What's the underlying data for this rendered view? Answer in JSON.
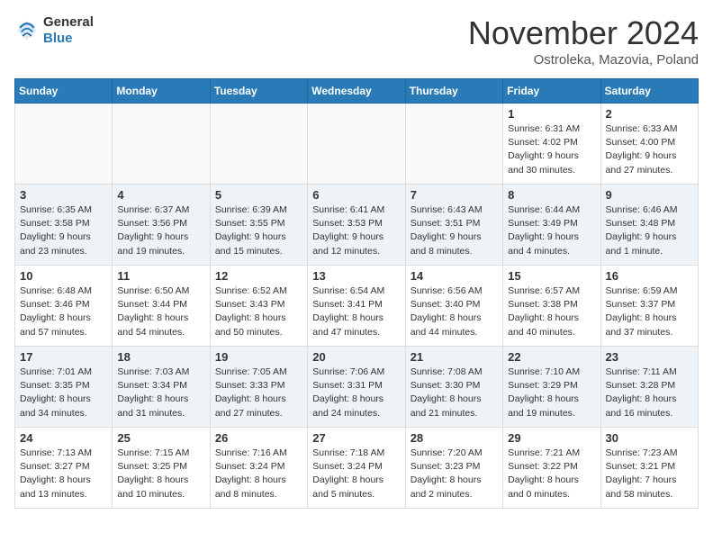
{
  "header": {
    "logo_general": "General",
    "logo_blue": "Blue",
    "month_title": "November 2024",
    "subtitle": "Ostroleka, Mazovia, Poland"
  },
  "weekdays": [
    "Sunday",
    "Monday",
    "Tuesday",
    "Wednesday",
    "Thursday",
    "Friday",
    "Saturday"
  ],
  "weeks": [
    [
      {
        "day": "",
        "sunrise": "",
        "sunset": "",
        "daylight": "",
        "empty": true
      },
      {
        "day": "",
        "sunrise": "",
        "sunset": "",
        "daylight": "",
        "empty": true
      },
      {
        "day": "",
        "sunrise": "",
        "sunset": "",
        "daylight": "",
        "empty": true
      },
      {
        "day": "",
        "sunrise": "",
        "sunset": "",
        "daylight": "",
        "empty": true
      },
      {
        "day": "",
        "sunrise": "",
        "sunset": "",
        "daylight": "",
        "empty": true
      },
      {
        "day": "1",
        "sunrise": "Sunrise: 6:31 AM",
        "sunset": "Sunset: 4:02 PM",
        "daylight": "Daylight: 9 hours and 30 minutes.",
        "empty": false
      },
      {
        "day": "2",
        "sunrise": "Sunrise: 6:33 AM",
        "sunset": "Sunset: 4:00 PM",
        "daylight": "Daylight: 9 hours and 27 minutes.",
        "empty": false
      }
    ],
    [
      {
        "day": "3",
        "sunrise": "Sunrise: 6:35 AM",
        "sunset": "Sunset: 3:58 PM",
        "daylight": "Daylight: 9 hours and 23 minutes.",
        "empty": false
      },
      {
        "day": "4",
        "sunrise": "Sunrise: 6:37 AM",
        "sunset": "Sunset: 3:56 PM",
        "daylight": "Daylight: 9 hours and 19 minutes.",
        "empty": false
      },
      {
        "day": "5",
        "sunrise": "Sunrise: 6:39 AM",
        "sunset": "Sunset: 3:55 PM",
        "daylight": "Daylight: 9 hours and 15 minutes.",
        "empty": false
      },
      {
        "day": "6",
        "sunrise": "Sunrise: 6:41 AM",
        "sunset": "Sunset: 3:53 PM",
        "daylight": "Daylight: 9 hours and 12 minutes.",
        "empty": false
      },
      {
        "day": "7",
        "sunrise": "Sunrise: 6:43 AM",
        "sunset": "Sunset: 3:51 PM",
        "daylight": "Daylight: 9 hours and 8 minutes.",
        "empty": false
      },
      {
        "day": "8",
        "sunrise": "Sunrise: 6:44 AM",
        "sunset": "Sunset: 3:49 PM",
        "daylight": "Daylight: 9 hours and 4 minutes.",
        "empty": false
      },
      {
        "day": "9",
        "sunrise": "Sunrise: 6:46 AM",
        "sunset": "Sunset: 3:48 PM",
        "daylight": "Daylight: 9 hours and 1 minute.",
        "empty": false
      }
    ],
    [
      {
        "day": "10",
        "sunrise": "Sunrise: 6:48 AM",
        "sunset": "Sunset: 3:46 PM",
        "daylight": "Daylight: 8 hours and 57 minutes.",
        "empty": false
      },
      {
        "day": "11",
        "sunrise": "Sunrise: 6:50 AM",
        "sunset": "Sunset: 3:44 PM",
        "daylight": "Daylight: 8 hours and 54 minutes.",
        "empty": false
      },
      {
        "day": "12",
        "sunrise": "Sunrise: 6:52 AM",
        "sunset": "Sunset: 3:43 PM",
        "daylight": "Daylight: 8 hours and 50 minutes.",
        "empty": false
      },
      {
        "day": "13",
        "sunrise": "Sunrise: 6:54 AM",
        "sunset": "Sunset: 3:41 PM",
        "daylight": "Daylight: 8 hours and 47 minutes.",
        "empty": false
      },
      {
        "day": "14",
        "sunrise": "Sunrise: 6:56 AM",
        "sunset": "Sunset: 3:40 PM",
        "daylight": "Daylight: 8 hours and 44 minutes.",
        "empty": false
      },
      {
        "day": "15",
        "sunrise": "Sunrise: 6:57 AM",
        "sunset": "Sunset: 3:38 PM",
        "daylight": "Daylight: 8 hours and 40 minutes.",
        "empty": false
      },
      {
        "day": "16",
        "sunrise": "Sunrise: 6:59 AM",
        "sunset": "Sunset: 3:37 PM",
        "daylight": "Daylight: 8 hours and 37 minutes.",
        "empty": false
      }
    ],
    [
      {
        "day": "17",
        "sunrise": "Sunrise: 7:01 AM",
        "sunset": "Sunset: 3:35 PM",
        "daylight": "Daylight: 8 hours and 34 minutes.",
        "empty": false
      },
      {
        "day": "18",
        "sunrise": "Sunrise: 7:03 AM",
        "sunset": "Sunset: 3:34 PM",
        "daylight": "Daylight: 8 hours and 31 minutes.",
        "empty": false
      },
      {
        "day": "19",
        "sunrise": "Sunrise: 7:05 AM",
        "sunset": "Sunset: 3:33 PM",
        "daylight": "Daylight: 8 hours and 27 minutes.",
        "empty": false
      },
      {
        "day": "20",
        "sunrise": "Sunrise: 7:06 AM",
        "sunset": "Sunset: 3:31 PM",
        "daylight": "Daylight: 8 hours and 24 minutes.",
        "empty": false
      },
      {
        "day": "21",
        "sunrise": "Sunrise: 7:08 AM",
        "sunset": "Sunset: 3:30 PM",
        "daylight": "Daylight: 8 hours and 21 minutes.",
        "empty": false
      },
      {
        "day": "22",
        "sunrise": "Sunrise: 7:10 AM",
        "sunset": "Sunset: 3:29 PM",
        "daylight": "Daylight: 8 hours and 19 minutes.",
        "empty": false
      },
      {
        "day": "23",
        "sunrise": "Sunrise: 7:11 AM",
        "sunset": "Sunset: 3:28 PM",
        "daylight": "Daylight: 8 hours and 16 minutes.",
        "empty": false
      }
    ],
    [
      {
        "day": "24",
        "sunrise": "Sunrise: 7:13 AM",
        "sunset": "Sunset: 3:27 PM",
        "daylight": "Daylight: 8 hours and 13 minutes.",
        "empty": false
      },
      {
        "day": "25",
        "sunrise": "Sunrise: 7:15 AM",
        "sunset": "Sunset: 3:25 PM",
        "daylight": "Daylight: 8 hours and 10 minutes.",
        "empty": false
      },
      {
        "day": "26",
        "sunrise": "Sunrise: 7:16 AM",
        "sunset": "Sunset: 3:24 PM",
        "daylight": "Daylight: 8 hours and 8 minutes.",
        "empty": false
      },
      {
        "day": "27",
        "sunrise": "Sunrise: 7:18 AM",
        "sunset": "Sunset: 3:24 PM",
        "daylight": "Daylight: 8 hours and 5 minutes.",
        "empty": false
      },
      {
        "day": "28",
        "sunrise": "Sunrise: 7:20 AM",
        "sunset": "Sunset: 3:23 PM",
        "daylight": "Daylight: 8 hours and 2 minutes.",
        "empty": false
      },
      {
        "day": "29",
        "sunrise": "Sunrise: 7:21 AM",
        "sunset": "Sunset: 3:22 PM",
        "daylight": "Daylight: 8 hours and 0 minutes.",
        "empty": false
      },
      {
        "day": "30",
        "sunrise": "Sunrise: 7:23 AM",
        "sunset": "Sunset: 3:21 PM",
        "daylight": "Daylight: 7 hours and 58 minutes.",
        "empty": false
      }
    ]
  ]
}
